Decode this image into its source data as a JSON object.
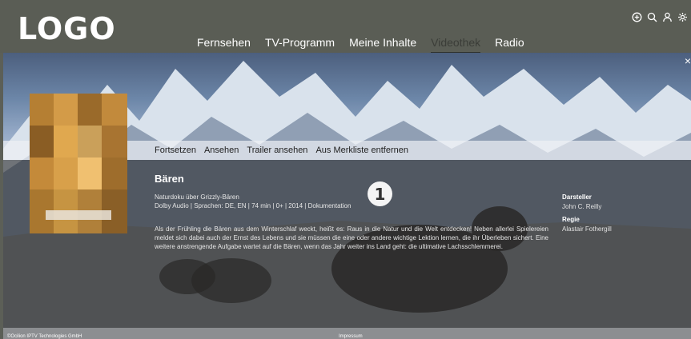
{
  "header": {
    "logo": "LOGO",
    "nav": [
      {
        "label": "Fernsehen",
        "active": false
      },
      {
        "label": "TV-Programm",
        "active": false
      },
      {
        "label": "Meine Inhalte",
        "active": false
      },
      {
        "label": "Videothek",
        "active": true
      },
      {
        "label": "Radio",
        "active": false
      }
    ],
    "icons": [
      "add-icon",
      "search-icon",
      "user-icon",
      "gear-icon"
    ]
  },
  "detail": {
    "close": "×",
    "actions": [
      "Fortsetzen",
      "Ansehen",
      "Trailer ansehen",
      "Aus Merkliste entfernen"
    ],
    "title": "Bären",
    "subtitle": "Naturdoku über Grizzly-Bären",
    "meta": "Dolby Audio | Sprachen: DE, EN | 74 min | 0+ | 2014 | Dokumentation",
    "description": "Als der Frühling die Bären aus dem Winterschlaf weckt, heißt es: Raus in die Natur und die Welt entdecken! Neben allerlei Spielereien meldet sich dabei auch der Ernst des Lebens und sie müssen die eine oder andere wichtige Lektion lernen, die ihr Überleben sichert. Eine weitere anstrengende Aufgabe wartet auf die Bären, wenn das Jahr weiter ins Land geht: die ultimative Lachsschlemmerei.",
    "badge": "1",
    "cast_label": "Darsteller",
    "cast_value": "John C. Reilly",
    "director_label": "Regie",
    "director_value": "Alastair Fothergill"
  },
  "footer": {
    "copyright": "©Ocilion IPTV Technologies GmbH",
    "impressum": "Impressum"
  },
  "colors": {
    "header_bg": "#5a5d55",
    "active_nav": "#3b3d38"
  }
}
